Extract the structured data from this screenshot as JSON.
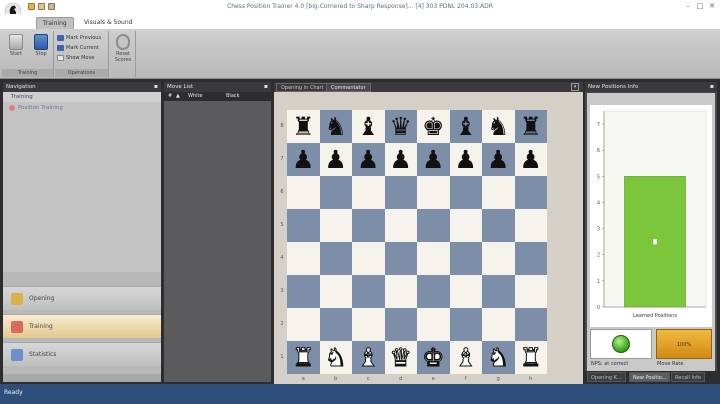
{
  "window": {
    "title": "Chess Position Trainer 4.0 [big:Cornered to Sharp Response]... [4] 303 PDNL 204.03.ADR",
    "controls": {
      "minimize": "–",
      "maximize": "□",
      "close": "✕"
    }
  },
  "ribbon": {
    "tabs": [
      {
        "label": "Training",
        "active": true
      },
      {
        "label": "Visuals & Sound",
        "active": false
      }
    ],
    "groups": {
      "training": {
        "caption": "Training",
        "start_label": "Start",
        "stop_label": "Stop"
      },
      "operations": {
        "caption": "Operations",
        "mark_previous": "Mark Previous",
        "mark_current": "Mark Current",
        "show_move": "Show Move"
      },
      "reset": {
        "label": "Reset Scores"
      }
    }
  },
  "navigation": {
    "header": "Navigation",
    "tree": {
      "group": "Training",
      "item": "Position Training"
    },
    "buttons": [
      {
        "label": "Opening",
        "active": false,
        "icon": "opening-icon",
        "color": "#d6b24a"
      },
      {
        "label": "Training",
        "active": true,
        "icon": "training-icon",
        "color": "#d96a5f"
      },
      {
        "label": "Statistics",
        "active": false,
        "icon": "statistics-icon",
        "color": "#6c8fc9"
      }
    ]
  },
  "movelist": {
    "header": "Move List",
    "columns": [
      "#",
      "▲",
      "White",
      "Black"
    ]
  },
  "board_panel": {
    "tabs": [
      {
        "label": "Opening in Chart",
        "active": false
      },
      {
        "label": "Commentator",
        "active": true
      }
    ],
    "ranks": [
      "8",
      "7",
      "6",
      "5",
      "4",
      "3",
      "2",
      "1"
    ],
    "files": [
      "a",
      "b",
      "c",
      "d",
      "e",
      "f",
      "g",
      "h"
    ],
    "position": [
      [
        "br",
        "bn",
        "bb",
        "bq",
        "bk",
        "bb",
        "bn",
        "br"
      ],
      [
        "bp",
        "bp",
        "bp",
        "bp",
        "bp",
        "bp",
        "bp",
        "bp"
      ],
      [
        "",
        "",
        "",
        "",
        "",
        "",
        "",
        ""
      ],
      [
        "",
        "",
        "",
        "",
        "",
        "",
        "",
        ""
      ],
      [
        "",
        "",
        "",
        "",
        "",
        "",
        "",
        ""
      ],
      [
        "",
        "",
        "",
        "",
        "",
        "",
        "",
        ""
      ],
      [
        "",
        "",
        "",
        "",
        "",
        "",
        "",
        ""
      ],
      [
        "wr",
        "wn",
        "wb",
        "wq",
        "wk",
        "wb",
        "wn",
        "wr"
      ]
    ],
    "colors": {
      "light": "#f6f3ec",
      "dark": "#7d8ea8"
    }
  },
  "info_panel": {
    "header": "New Positions Info",
    "chart_data": {
      "type": "bar",
      "categories": [
        "Learned Positions"
      ],
      "values": [
        5
      ],
      "ylim": [
        0,
        7.5
      ],
      "yticks": [
        "0",
        "1",
        "2",
        "3",
        "4",
        "5",
        "6",
        "7"
      ],
      "bar_color": "#7cc63b"
    },
    "rate_value": "100%",
    "captions": {
      "nps": "NPS: at correct",
      "move_rate": "Move Rate"
    },
    "tabs": [
      {
        "label": "Opening K...",
        "active": false
      },
      {
        "label": "New Positio...",
        "active": true
      },
      {
        "label": "Recall Info",
        "active": false
      }
    ]
  },
  "status": {
    "text": "Ready"
  }
}
